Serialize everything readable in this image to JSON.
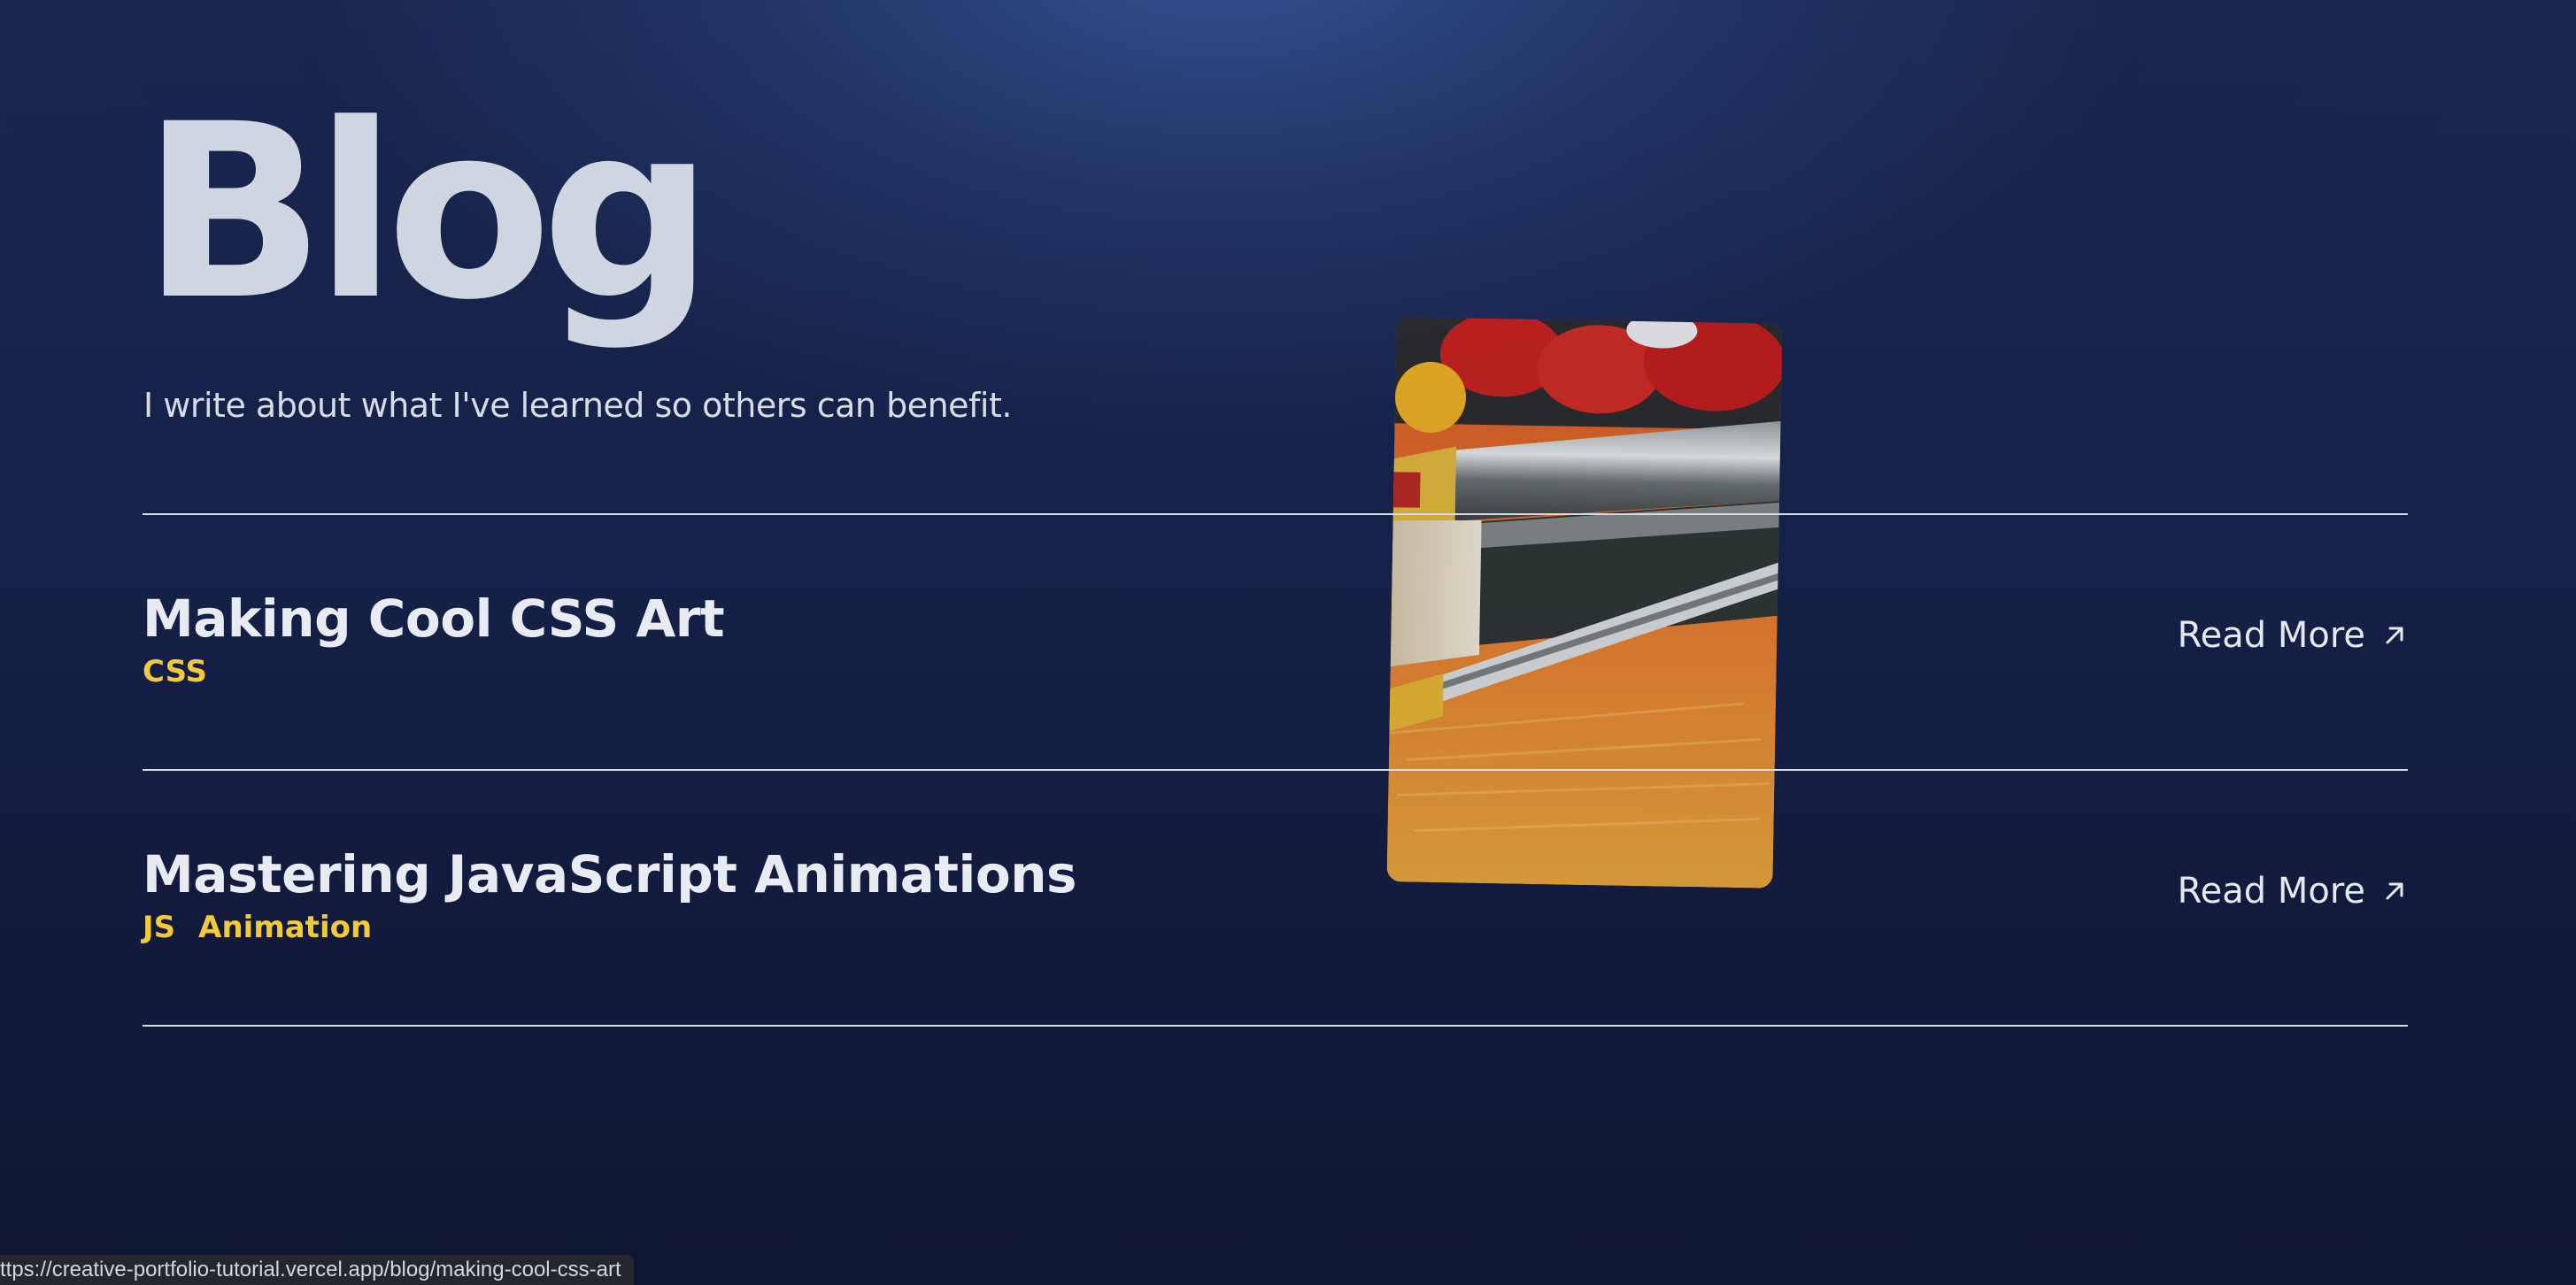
{
  "header": {
    "title": "Blog",
    "subtitle": "I write about what I've learned so others can benefit."
  },
  "posts": [
    {
      "title": "Making Cool CSS Art",
      "tags": [
        "CSS"
      ],
      "read_more_label": "Read More"
    },
    {
      "title": "Mastering JavaScript Animations",
      "tags": [
        "JS",
        "Animation"
      ],
      "read_more_label": "Read More"
    }
  ],
  "status_bar": {
    "url": "ttps://creative-portfolio-tutorial.vercel.app/blog/making-cool-css-art"
  },
  "colors": {
    "background": "#16214a",
    "accent_tag": "#f2c93a",
    "text": "#e8ebf2",
    "divider": "#d8dce4"
  },
  "icons": {
    "read_more": "arrow-up-right-icon"
  }
}
